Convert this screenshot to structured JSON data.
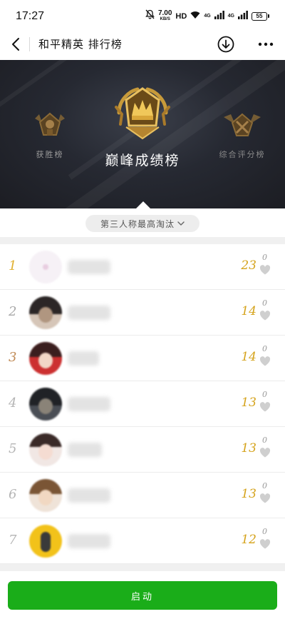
{
  "status_bar": {
    "time": "17:27",
    "net_speed": "7.00",
    "net_unit": "KB/S",
    "hd_label": "HD",
    "network_1": "4G",
    "network_2": "4G",
    "battery": "55",
    "icons": [
      "mute-bell-icon",
      "wifi-icon",
      "signal-icon",
      "signal-icon",
      "battery-icon"
    ]
  },
  "header": {
    "title": "和平精英 排行榜",
    "icons": [
      "back-arrow-icon",
      "download-circle-icon",
      "more-dots-icon"
    ]
  },
  "banner": {
    "tabs": [
      {
        "label": "获胜榜",
        "icon": "winner-badge-icon",
        "selected": false
      },
      {
        "label": "巅峰成绩榜",
        "icon": "peak-crown-badge-icon",
        "selected": true
      },
      {
        "label": "综合评分榜",
        "icon": "rating-wings-badge-icon",
        "selected": false
      }
    ]
  },
  "mode_selector": {
    "value": "第三人称最高淘汰",
    "icon": "chevron-down-icon"
  },
  "rankings": [
    {
      "rank": "1",
      "score": "23",
      "likes": "0"
    },
    {
      "rank": "2",
      "score": "14",
      "likes": "0"
    },
    {
      "rank": "3",
      "score": "14",
      "likes": "0"
    },
    {
      "rank": "4",
      "score": "13",
      "likes": "0"
    },
    {
      "rank": "5",
      "score": "13",
      "likes": "0"
    },
    {
      "rank": "6",
      "score": "13",
      "likes": "0"
    },
    {
      "rank": "7",
      "score": "12",
      "likes": "0"
    }
  ],
  "colors": {
    "rank_1": "#e0b030",
    "rank_2": "#a8a8a8",
    "rank_3": "#c08a55",
    "rank_other": "#b5b5b5",
    "score": "#d5a31c",
    "launch_button": "#1aad19",
    "banner_bg": "#262932"
  },
  "launch_button": {
    "label": "启动"
  }
}
